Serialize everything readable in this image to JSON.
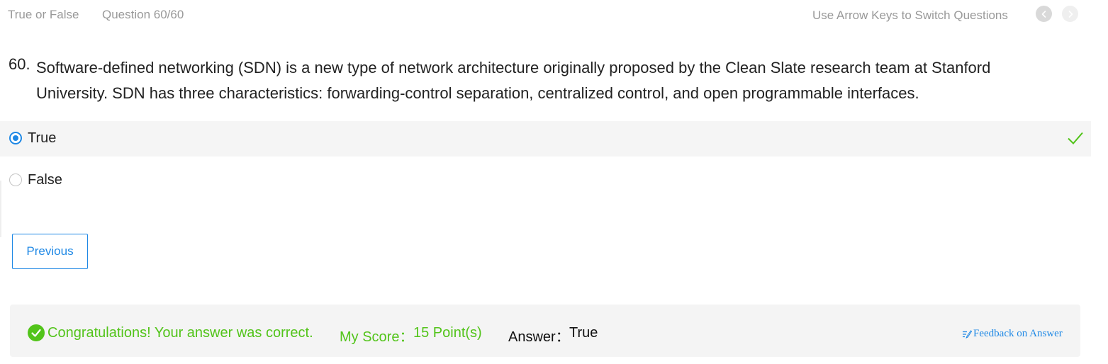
{
  "header": {
    "question_type": "True or False",
    "question_counter": "Question 60/60",
    "nav_hint": "Use Arrow Keys to Switch Questions"
  },
  "question": {
    "number": "60.",
    "text": "Software-defined networking (SDN) is a new type of network architecture originally proposed by the Clean Slate research team at Stanford University. SDN has three characteristics: forwarding-control separation, centralized control, and open programmable interfaces."
  },
  "options": [
    {
      "label": "True",
      "selected": true,
      "correct": true
    },
    {
      "label": "False",
      "selected": false,
      "correct": false
    }
  ],
  "buttons": {
    "previous": "Previous"
  },
  "result": {
    "message": "Congratulations! Your answer was correct.",
    "score_label": "My Score：",
    "score_value": "15 Point(s)",
    "answer_label": "Answer：",
    "answer_value": "True",
    "feedback_link": "Feedback on Answer"
  },
  "colors": {
    "accent": "#1e88e5",
    "success": "#52c41a",
    "muted": "#999999"
  },
  "icons": {
    "nav_prev": "chevron-left-icon",
    "nav_next": "chevron-right-icon",
    "correct": "checkmark-icon",
    "success": "check-circle-icon",
    "feedback": "edit-list-icon"
  }
}
